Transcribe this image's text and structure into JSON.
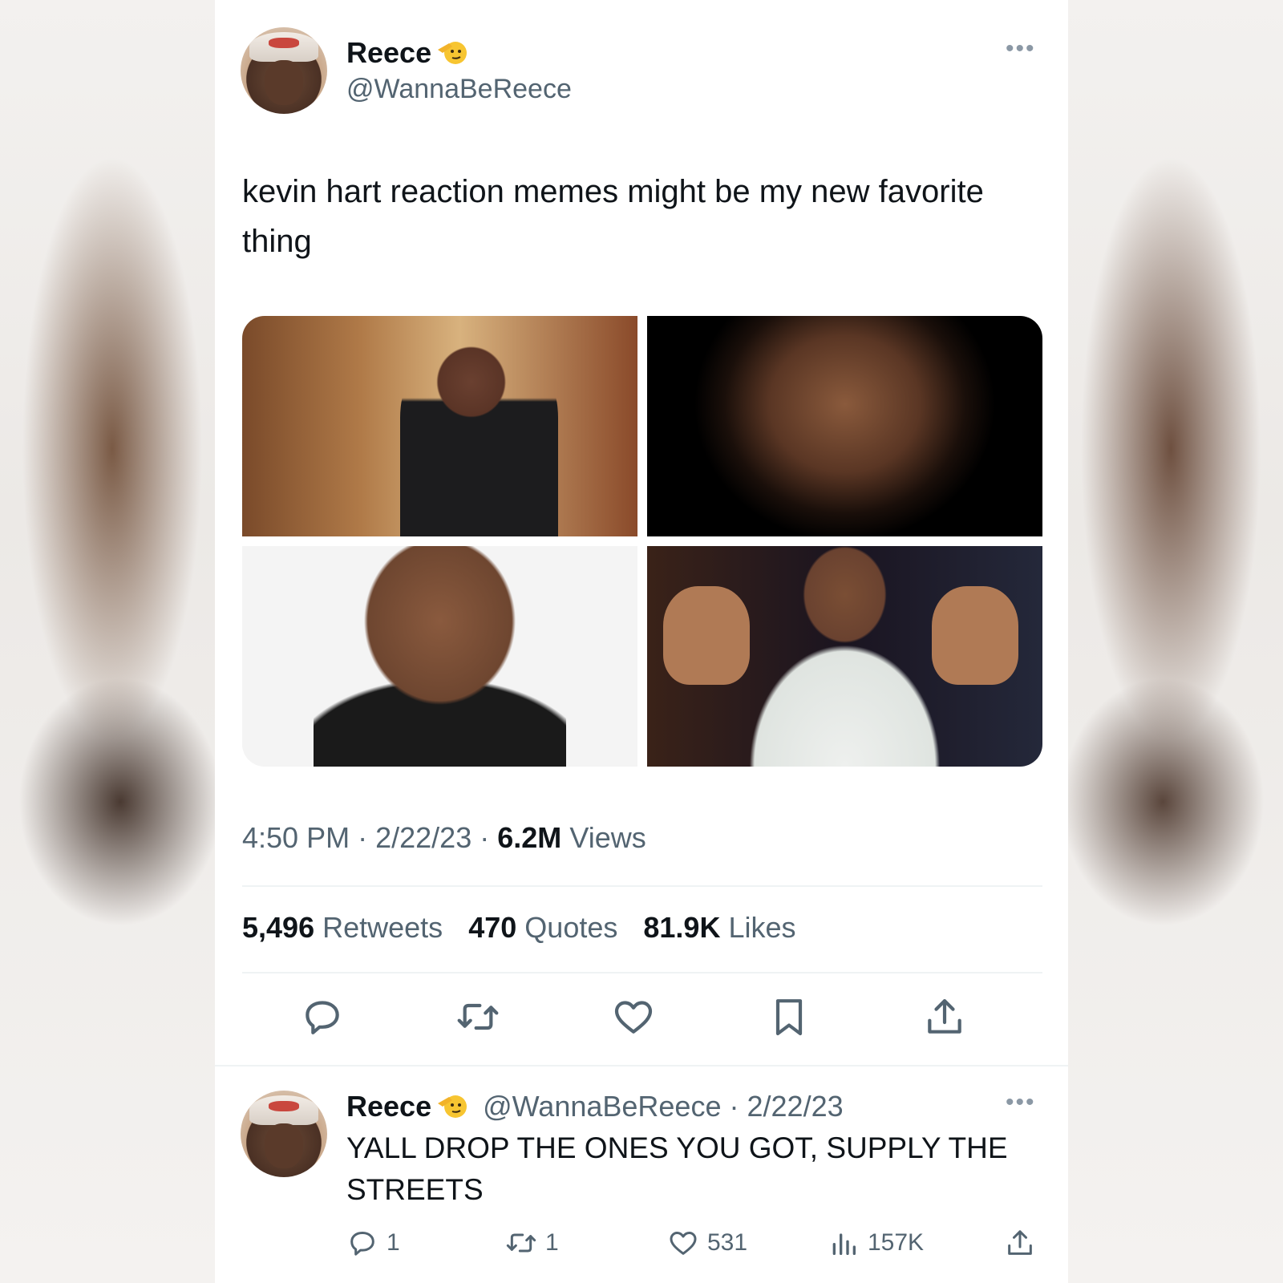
{
  "tweet": {
    "author_name": "Reece",
    "author_handle": "@WannaBeReece",
    "more_label": "•••",
    "text": "kevin hart reaction memes might be my new favorite thing",
    "time": "4:50 PM",
    "date": "2/22/23",
    "views_count": "6.2M",
    "views_label": "Views",
    "separator": "·",
    "stats": {
      "retweets_count": "5,496",
      "retweets_label": "Retweets",
      "quotes_count": "470",
      "quotes_label": "Quotes",
      "likes_count": "81.9K",
      "likes_label": "Likes"
    },
    "icons": [
      "reply-icon",
      "retweet-icon",
      "like-icon",
      "bookmark-icon",
      "share-icon"
    ]
  },
  "reply": {
    "author_name": "Reece",
    "author_handle": "@WannaBeReece",
    "separator": "·",
    "date": "2/22/23",
    "more_label": "•••",
    "text": "YALL DROP THE ONES YOU GOT, SUPPLY THE STREETS",
    "reply_count": "1",
    "retweet_count": "1",
    "like_count": "531",
    "views_count": "157K"
  },
  "colors": {
    "text_primary": "#0f1419",
    "text_secondary": "#536471",
    "divider": "#eff3f4",
    "card_background": "#ffffff"
  }
}
